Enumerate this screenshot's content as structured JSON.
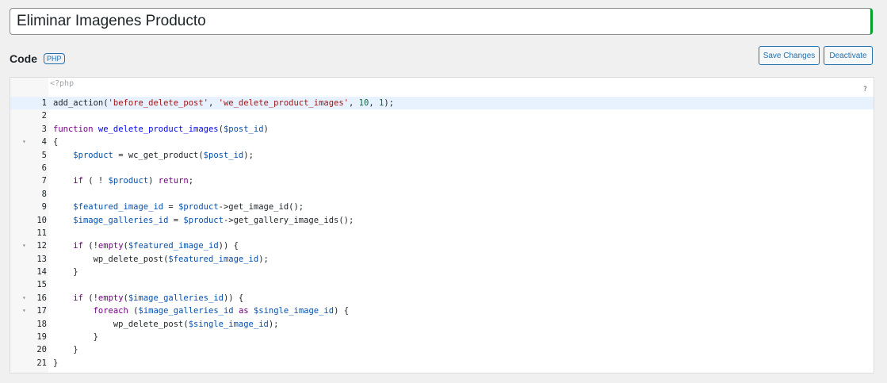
{
  "snippet": {
    "title": "Eliminar Imagenes Producto"
  },
  "code_section": {
    "label": "Code",
    "badge": "PHP",
    "php_open_tag": "<?php",
    "help": "?"
  },
  "buttons": {
    "save": "Save Changes",
    "deactivate": "Deactivate"
  },
  "colors": {
    "accent": "#2271b1",
    "title_border_right": "#00a32a",
    "active_line": "#e8f2ff",
    "string": "#a31515",
    "keyword": "#770088",
    "variable": "#0550ae"
  },
  "editor": {
    "active_line": 1,
    "fold_lines": [
      4,
      12,
      16,
      17
    ],
    "lines": [
      [
        [
          "",
          "add_action("
        ],
        [
          "str",
          "'before_delete_post'"
        ],
        [
          "",
          ", "
        ],
        [
          "str",
          "'we_delete_product_images'"
        ],
        [
          "",
          ", "
        ],
        [
          "num",
          "10"
        ],
        [
          "",
          ", "
        ],
        [
          "num",
          "1"
        ],
        [
          "",
          ");"
        ]
      ],
      [],
      [
        [
          "kw",
          "function"
        ],
        [
          "",
          " "
        ],
        [
          "def",
          "we_delete_product_images"
        ],
        [
          "",
          "("
        ],
        [
          "var",
          "$post_id"
        ],
        [
          "",
          ")"
        ]
      ],
      [
        [
          "",
          "{"
        ]
      ],
      [
        [
          "",
          "    "
        ],
        [
          "var",
          "$product"
        ],
        [
          "",
          " = wc_get_product("
        ],
        [
          "var",
          "$post_id"
        ],
        [
          "",
          ");"
        ]
      ],
      [],
      [
        [
          "",
          "    "
        ],
        [
          "kw",
          "if"
        ],
        [
          "",
          " ( ! "
        ],
        [
          "var",
          "$product"
        ],
        [
          "",
          ") "
        ],
        [
          "kw",
          "return"
        ],
        [
          "",
          ";"
        ]
      ],
      [],
      [
        [
          "",
          "    "
        ],
        [
          "var",
          "$featured_image_id"
        ],
        [
          "",
          " = "
        ],
        [
          "var",
          "$product"
        ],
        [
          "",
          "->get_image_id();"
        ]
      ],
      [
        [
          "",
          "    "
        ],
        [
          "var",
          "$image_galleries_id"
        ],
        [
          "",
          " = "
        ],
        [
          "var",
          "$product"
        ],
        [
          "",
          "->get_gallery_image_ids();"
        ]
      ],
      [],
      [
        [
          "",
          "    "
        ],
        [
          "kw",
          "if"
        ],
        [
          "",
          " (!"
        ],
        [
          "kw",
          "empty"
        ],
        [
          "",
          "("
        ],
        [
          "var",
          "$featured_image_id"
        ],
        [
          "",
          ")) {"
        ]
      ],
      [
        [
          "",
          "        wp_delete_post("
        ],
        [
          "var",
          "$featured_image_id"
        ],
        [
          "",
          ");"
        ]
      ],
      [
        [
          "",
          "    }"
        ]
      ],
      [],
      [
        [
          "",
          "    "
        ],
        [
          "kw",
          "if"
        ],
        [
          "",
          " (!"
        ],
        [
          "kw",
          "empty"
        ],
        [
          "",
          "("
        ],
        [
          "var",
          "$image_galleries_id"
        ],
        [
          "",
          ")) {"
        ]
      ],
      [
        [
          "",
          "        "
        ],
        [
          "kw",
          "foreach"
        ],
        [
          "",
          " ("
        ],
        [
          "var",
          "$image_galleries_id"
        ],
        [
          "",
          " "
        ],
        [
          "kw",
          "as"
        ],
        [
          "",
          " "
        ],
        [
          "var",
          "$single_image_id"
        ],
        [
          "",
          ") {"
        ]
      ],
      [
        [
          "",
          "            wp_delete_post("
        ],
        [
          "var",
          "$single_image_id"
        ],
        [
          "",
          ");"
        ]
      ],
      [
        [
          "",
          "        }"
        ]
      ],
      [
        [
          "",
          "    }"
        ]
      ],
      [
        [
          "",
          "}"
        ]
      ]
    ]
  }
}
